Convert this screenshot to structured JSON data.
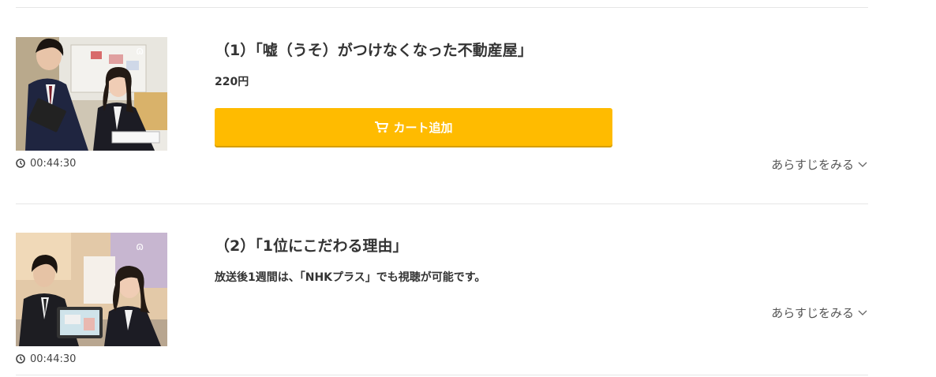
{
  "episodes": [
    {
      "title": "（1）「嘘（うそ）がつけなくなった不動産屋」",
      "price": "220円",
      "cart_label": "カート追加",
      "duration": "00:44:30",
      "synopsis_label": "あらすじをみる",
      "thumbnail_logo": "nhk-ondemand-logo"
    },
    {
      "title": "（2）「1位にこだわる理由」",
      "note": "放送後1週間は、「NHKプラス」でも視聴が可能です。",
      "duration": "00:44:30",
      "synopsis_label": "あらすじをみる",
      "thumbnail_logo": "nhk-ondemand-logo"
    }
  ],
  "colors": {
    "cart_button": "#ffbb00",
    "divider": "#e6e6e6",
    "text": "#333333"
  }
}
